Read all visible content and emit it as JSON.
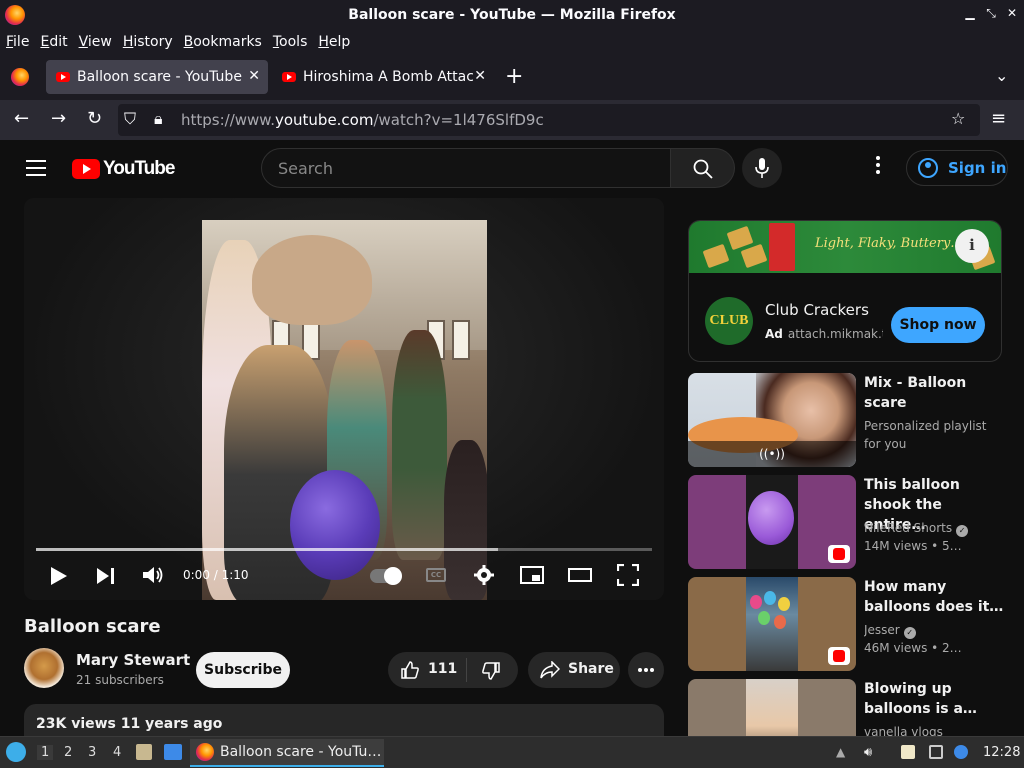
{
  "window": {
    "title": "Balloon scare - YouTube — Mozilla Firefox"
  },
  "menu": [
    "File",
    "Edit",
    "View",
    "History",
    "Bookmarks",
    "Tools",
    "Help"
  ],
  "tabs": [
    {
      "label": "Balloon scare - YouTube",
      "active": true
    },
    {
      "label": "Hiroshima A Bomb Attack",
      "active": false
    }
  ],
  "nav": {
    "url_prefix": "https://www.",
    "url_domain": "youtube.com",
    "url_path": "/watch?v=1l476SlfD9c"
  },
  "youtube": {
    "logo_text": "YouTube",
    "search_placeholder": "Search",
    "sign_in": "Sign in",
    "player": {
      "time": "0:00 / 1:10",
      "progress_fraction": 0.75
    },
    "video": {
      "title": "Balloon scare",
      "channel": "Mary Stewart",
      "subscribers": "21 subscribers",
      "subscribe_label": "Subscribe",
      "likes": "111",
      "share_label": "Share",
      "meta": "23K views  11 years ago"
    },
    "ad": {
      "tagline": "Light, Flaky, Buttery…",
      "logo_text": "CLUB",
      "brand": "Club Crackers",
      "ad_label": "Ad",
      "domain": "attach.mikmak.t",
      "cta": "Shop now"
    },
    "recommendations": [
      {
        "title": "Mix - Balloon scare",
        "line1": "Personalized playlist for you",
        "line2": "",
        "verified": false,
        "shorts": false
      },
      {
        "title": "This balloon shook the entire…",
        "line1": "NileRed Shorts",
        "line2": "14M views • 5…",
        "verified": true,
        "shorts": true
      },
      {
        "title": "How many balloons does it…",
        "line1": "Jesser",
        "line2": "46M views • 2…",
        "verified": true,
        "shorts": true
      },
      {
        "title": "Blowing up balloons is a…",
        "line1": "vanella vlogs",
        "line2": "",
        "verified": false,
        "shorts": false
      }
    ]
  },
  "taskbar": {
    "workspaces": [
      "1",
      "2",
      "3",
      "4"
    ],
    "window_label": "Balloon scare - YouTu…",
    "clock": "12:28"
  },
  "colors": {
    "accent": "#3ea6ff",
    "youtube_red": "#ff0000",
    "background": "#0f0f0f"
  }
}
